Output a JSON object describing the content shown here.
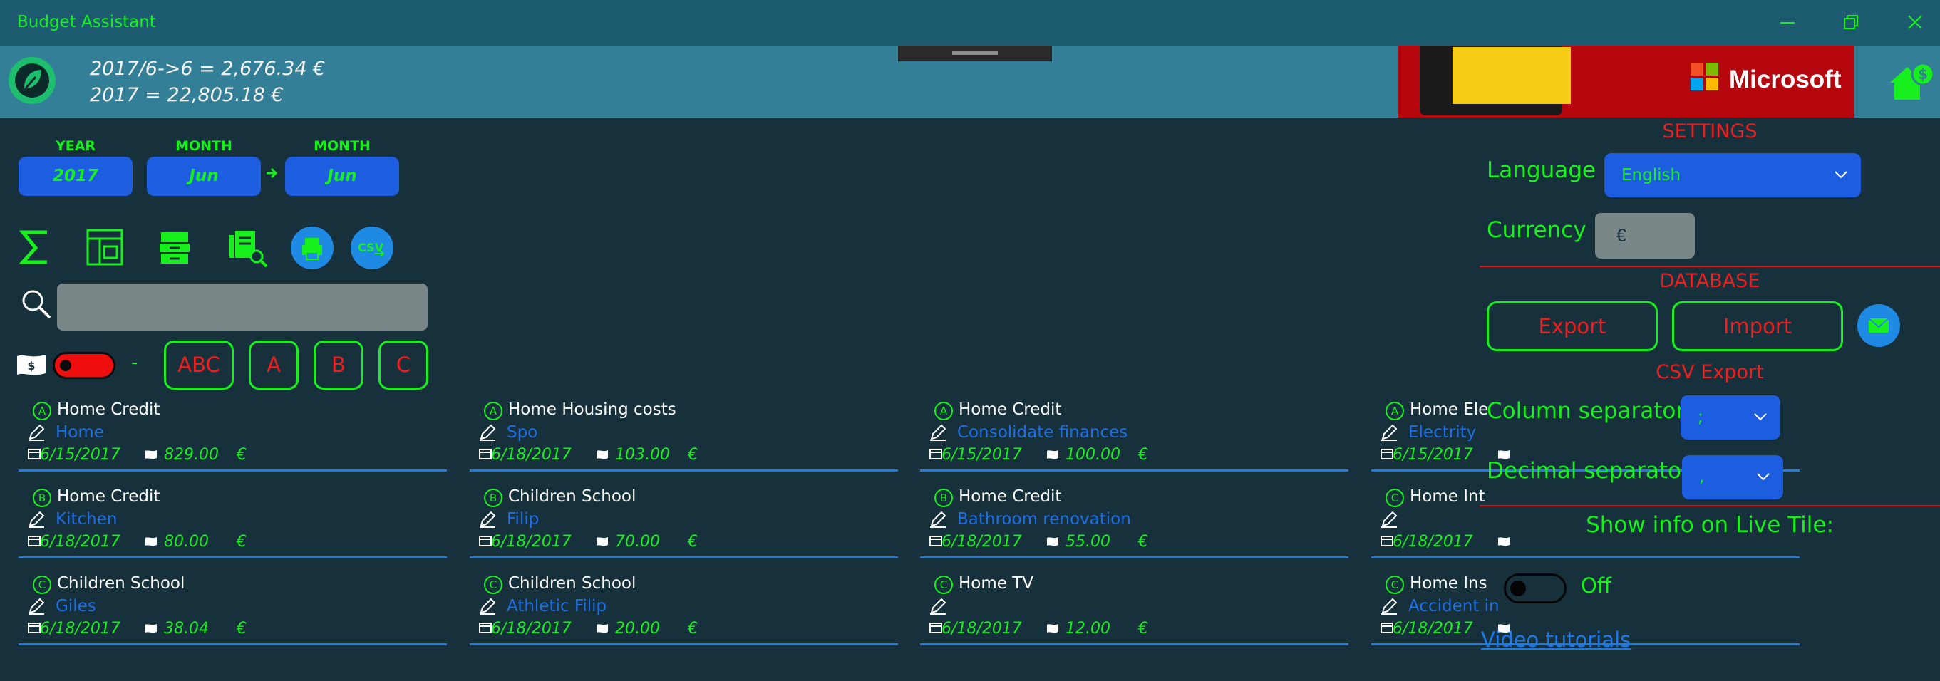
{
  "app": {
    "title": "Budget Assistant"
  },
  "colors": {
    "accent_green": "#18f01e",
    "button_blue": "#1d5de0",
    "alert_red": "#ee1e1e",
    "background": "#16303c",
    "header": "#347f98"
  },
  "summary": {
    "period_total": "2017/6->6 = 2,676.34 €",
    "year_total": "2017 = 22,805.18 €"
  },
  "ad": {
    "brand": "Microsoft"
  },
  "period": {
    "year_label": "YEAR",
    "year_value": "2017",
    "from_label": "MONTH",
    "from_value": "Jun",
    "to_label": "MONTH",
    "to_value": "Jun"
  },
  "toolbar": {
    "icons": [
      "sigma-icon",
      "report-icon",
      "archive-icon",
      "search-document-icon",
      "print-icon",
      "csv-export-icon"
    ]
  },
  "search": {
    "placeholder": "",
    "value": ""
  },
  "filters": {
    "dash": "-",
    "all_label": "ABC",
    "a_label": "A",
    "b_label": "B",
    "c_label": "C"
  },
  "expenses": [
    {
      "cat": "A",
      "title": "Home Credit",
      "desc": "Home",
      "date": "6/15/2017",
      "amount": "829.00",
      "currency": "€"
    },
    {
      "cat": "A",
      "title": "Home Housing costs",
      "desc": "Spo",
      "date": "6/18/2017",
      "amount": "103.00",
      "currency": "€"
    },
    {
      "cat": "A",
      "title": "Home Credit",
      "desc": "Consolidate finances",
      "date": "6/15/2017",
      "amount": "100.00",
      "currency": "€"
    },
    {
      "cat": "A",
      "title": "Home Ele",
      "desc": "Electrity",
      "date": "6/15/2017",
      "amount": "",
      "currency": ""
    },
    {
      "cat": "B",
      "title": "Home Credit",
      "desc": "Kitchen",
      "date": "6/18/2017",
      "amount": "80.00",
      "currency": "€"
    },
    {
      "cat": "B",
      "title": "Children School",
      "desc": "Filip",
      "date": "6/18/2017",
      "amount": "70.00",
      "currency": "€"
    },
    {
      "cat": "B",
      "title": "Home Credit",
      "desc": "Bathroom renovation",
      "date": "6/18/2017",
      "amount": "55.00",
      "currency": "€"
    },
    {
      "cat": "C",
      "title": "Home Int",
      "desc": "",
      "date": "6/18/2017",
      "amount": "",
      "currency": ""
    },
    {
      "cat": "C",
      "title": "Children School",
      "desc": "Giles",
      "date": "6/18/2017",
      "amount": "38.04",
      "currency": "€"
    },
    {
      "cat": "C",
      "title": "Children School",
      "desc": "Athletic Filip",
      "date": "6/18/2017",
      "amount": "20.00",
      "currency": "€"
    },
    {
      "cat": "C",
      "title": "Home TV",
      "desc": "",
      "date": "6/18/2017",
      "amount": "12.00",
      "currency": "€"
    },
    {
      "cat": "C",
      "title": "Home Ins",
      "desc": "Accident in",
      "date": "6/18/2017",
      "amount": "",
      "currency": ""
    }
  ],
  "settings": {
    "title": "SETTINGS",
    "language_label": "Language :",
    "language_value": "English",
    "currency_label": "Currency :",
    "currency_value": "€",
    "database_title": "DATABASE",
    "export_label": "Export",
    "import_label": "Import",
    "csv_title": "CSV Export",
    "column_sep_label": "Column separator:",
    "column_sep_value": ";",
    "decimal_sep_label": "Decimal separator:",
    "decimal_sep_value": ",",
    "live_tile_label": "Show info on Live Tile:",
    "live_tile_state": "Off",
    "video_link": "Video tutorials"
  }
}
